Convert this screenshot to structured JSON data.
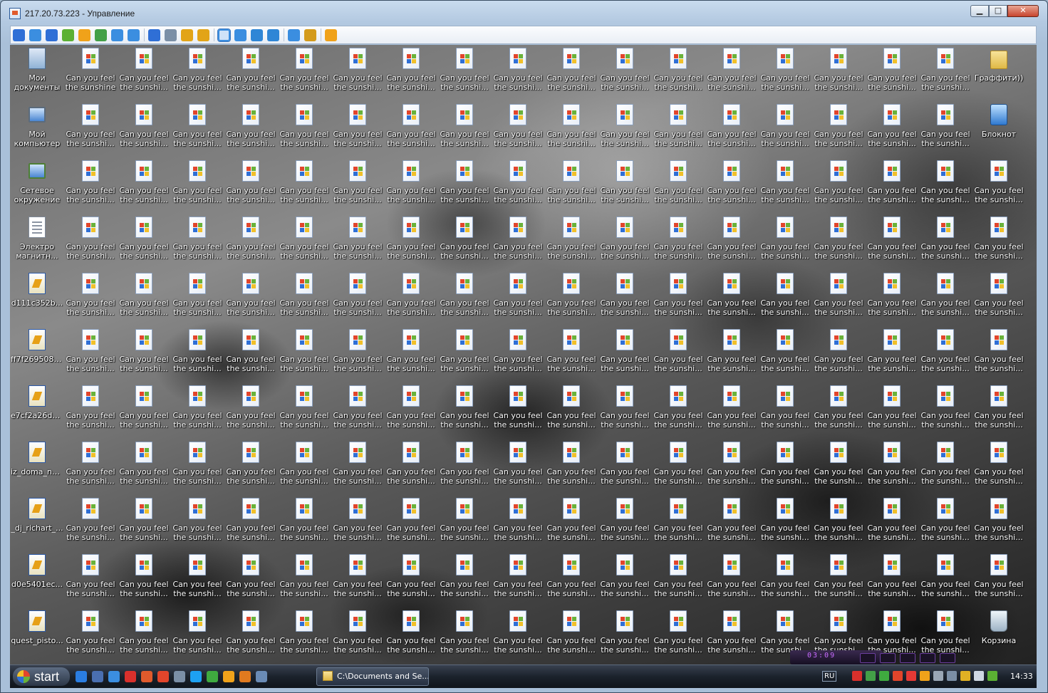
{
  "window": {
    "title": "217.20.73.223 - Управление",
    "caption_buttons": {
      "minimize": "▁",
      "maximize": "□",
      "close": "✕"
    }
  },
  "toolbar": {
    "buttons": [
      {
        "icon": "monitor-icon",
        "color": "#2f6fd6"
      },
      {
        "icon": "window-icon",
        "color": "#3b8ee0"
      },
      {
        "icon": "console-icon",
        "color": "#2f6fd6"
      },
      {
        "icon": "transfer-icon",
        "color": "#5bb033"
      },
      {
        "icon": "power-icon",
        "color": "#f0a21a"
      },
      {
        "icon": "chat-icon",
        "color": "#43a047"
      },
      {
        "icon": "phone-icon",
        "color": "#3b8ee0"
      },
      {
        "icon": "message-icon",
        "color": "#3b8ee0"
      },
      {
        "icon": "upload-icon",
        "color": "#2f6fd6"
      },
      {
        "icon": "users-icon",
        "color": "#7b8fa6"
      },
      {
        "icon": "lock-icon",
        "color": "#e2a417"
      },
      {
        "icon": "unlock-icon",
        "color": "#e2a417"
      },
      {
        "icon": "fullscreen-icon",
        "color": "#3b8ee0"
      },
      {
        "icon": "fit-icon",
        "color": "#3b8ee0"
      },
      {
        "icon": "scale-icon",
        "color": "#2f86d6"
      },
      {
        "icon": "zoom-icon",
        "color": "#2f86d6"
      },
      {
        "icon": "clipboard-icon",
        "color": "#3b8ee0"
      },
      {
        "icon": "tools-icon",
        "color": "#d49b1b"
      },
      {
        "icon": "close-session-icon",
        "color": "#f0a21a"
      }
    ]
  },
  "desktop": {
    "first_column": [
      {
        "icon": "my-documents-icon",
        "line1": "Мои",
        "line2": "документы"
      },
      {
        "icon": "my-computer-icon",
        "line1": "Мой",
        "line2": "компьютер"
      },
      {
        "icon": "network-icon",
        "line1": "Сетевое",
        "line2": "окружение"
      },
      {
        "icon": "text-file-icon",
        "line1": "Электро",
        "line2": "магнитн..."
      },
      {
        "icon": "shortcut-icon",
        "line1": "d111c352b...",
        "line2": ""
      },
      {
        "icon": "shortcut-icon",
        "line1": "ff7f2695080...",
        "line2": ""
      },
      {
        "icon": "shortcut-icon",
        "line1": "e7cf2a26d5...",
        "line2": ""
      },
      {
        "icon": "shortcut-icon",
        "line1": "iz_doma_na...",
        "line2": ""
      },
      {
        "icon": "shortcut-icon",
        "line1": "_dj_richart_...",
        "line2": ""
      },
      {
        "icon": "shortcut-icon",
        "line1": "d0e5401ec...",
        "line2": ""
      },
      {
        "icon": "shortcut-icon",
        "line1": "quest_pisto...",
        "line2": ""
      }
    ],
    "repeat_file": {
      "line1": "Can you feel",
      "line2_first": "the sunshine",
      "line2": "the sunshi..."
    },
    "special_column_19": [
      {
        "row": 0,
        "icon": "folder-icon",
        "line1": "Граффити))",
        "line2": ""
      },
      {
        "row": 1,
        "icon": "notepad-icon",
        "line1": "Блокнот",
        "line2": ""
      },
      {
        "row": 10,
        "icon": "recycle-bin-icon",
        "line1": "Корзина",
        "line2": ""
      }
    ],
    "partial_column": {
      "line1": "Ca",
      "line2": "th"
    }
  },
  "taskbar": {
    "start_label": "start",
    "quick_launch": [
      "ie-icon",
      "desktop-icon",
      "messenger-icon",
      "opera-icon",
      "mail-icon",
      "antivirus-icon",
      "media-icon",
      "skype-icon",
      "icq-icon",
      "winamp-icon",
      "firefox-icon",
      "network-tool-icon"
    ],
    "task_label": "C:\\Documents and Se...",
    "language": "RU",
    "tray": [
      "shield-icon",
      "update-icon",
      "chat-tray-icon",
      "app-tray-icon",
      "heart-icon",
      "media-tray-icon",
      "mute-icon",
      "disk-icon",
      "flash-icon",
      "volume-icon",
      "network-tray-icon"
    ],
    "clock": "14:33",
    "player_time": "03:09"
  }
}
